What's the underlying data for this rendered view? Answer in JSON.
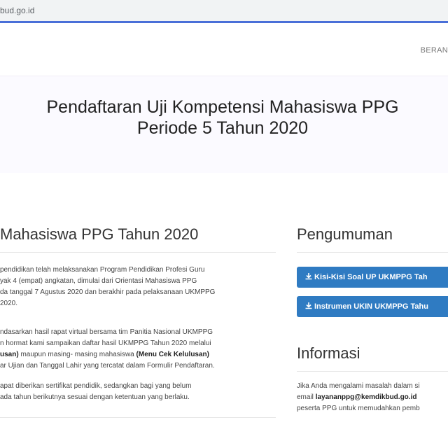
{
  "browser": {
    "url": "bud.go.id"
  },
  "nav": {
    "home": "BERAN"
  },
  "hero": {
    "title_line1": "Pendaftaran Uji Kompetensi Mahasiswa PPG",
    "title_line2": "Periode 5 Tahun 2020"
  },
  "main": {
    "title": "Mahasiswa PPG Tahun 2020",
    "p1": [
      "pendidikan telah melaksanakan Program Pendidikan Profesi Guru",
      "yak 4 (empat) angkatan, dimulai dari Orientasi Mahasiswa PPG",
      "da tanggal 7 Agustus 2020 dan berakhir pada pelaksanaan UKMPPG",
      "2020."
    ],
    "p2": {
      "line1": "ndasarkan hasil rapat virtual bersama tim Panitia Nasional UKMPPG",
      "line2": "n hormat kami sampaikan daftar hasil UKMPPG Tahun 2020 melalui",
      "line3_bold_a": "usan)",
      "line3_mid": " maupun masing- masing mahasiswa ",
      "line3_bold_b": "(Menu Cek Kelulusan)",
      "line4": "ar Ujian dan Tanggal Lahir yang tercatat dalam Formulir Pendaftaran."
    },
    "p3": [
      "apat diberikan sertifikat pendidik, sedangkan bagi yang belum",
      "ada tahun berikutnya sesuai dengan ketentuan yang berlaku."
    ]
  },
  "sidebar": {
    "announcement_title": "Pengumuman",
    "buttons": [
      {
        "label": "Kisi-Kisi Soal UP UKMPPG Tah",
        "icon": "download-icon"
      },
      {
        "label": "Instrumen UKIN UKMPPG Tahu",
        "icon": "download-icon"
      }
    ],
    "info_title": "Informasi",
    "info": {
      "line1": "Jika Anda mengalami masalah dalam si",
      "line2_prefix": "email ",
      "line2_email": "layananppg@kemdikbud.go.id",
      "line3": "peserta PPG untuk memudahkan pemb"
    }
  },
  "colors": {
    "accent": "#2f7bc2",
    "url_underline": "#4a6fd8",
    "hero_bg": "#fbfaff"
  }
}
